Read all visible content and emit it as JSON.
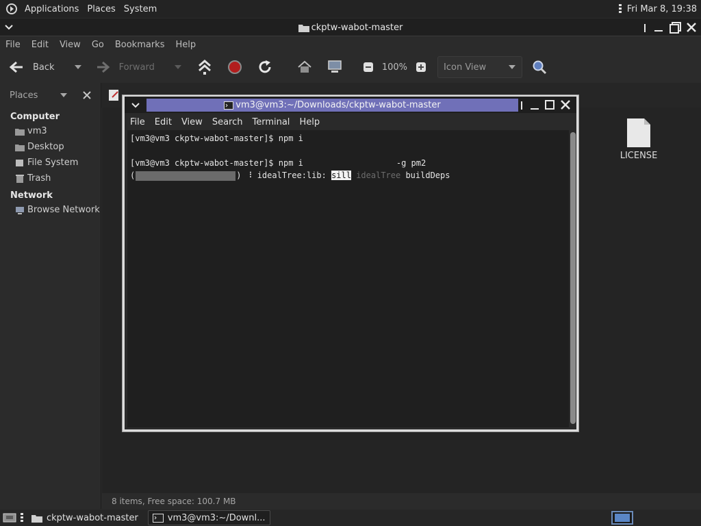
{
  "top_panel": {
    "menus": [
      "Applications",
      "Places",
      "System"
    ],
    "clock": "Fri Mar  8, 19:38"
  },
  "file_manager": {
    "title": "ckptw-wabot-master",
    "menus": [
      "File",
      "Edit",
      "View",
      "Go",
      "Bookmarks",
      "Help"
    ],
    "toolbar": {
      "back": "Back",
      "forward": "Forward",
      "zoom": "100%",
      "view_mode": "Icon View"
    },
    "sidebar": {
      "header": "Places",
      "sections": [
        {
          "title": "Computer",
          "items": [
            "vm3",
            "Desktop",
            "File System",
            "Trash"
          ]
        },
        {
          "title": "Network",
          "items": [
            "Browse Network"
          ]
        }
      ]
    },
    "files": [
      "LICENSE"
    ],
    "status": "8 items, Free space: 100.7 MB"
  },
  "terminal": {
    "title": "vm3@vm3:~/Downloads/ckptw-wabot-master",
    "menus": [
      "File",
      "Edit",
      "View",
      "Search",
      "Terminal",
      "Help"
    ],
    "lines": {
      "l1": "[vm3@vm3 ckptw-wabot-master]$ npm i",
      "l2_prompt": "[vm3@vm3 ckptw-wabot-master]$ npm i",
      "l2_flag": "-g pm2",
      "l3_open": "(",
      "l3_mid": ") ",
      "l3_spinner": "⠸",
      "l3_tree": " idealTree:lib: ",
      "l3_sill": "sill",
      "l3_ideal": " idealTree",
      "l3_deps": " buildDeps"
    }
  },
  "taskbar": {
    "tasks": [
      "ckptw-wabot-master",
      "vm3@vm3:~/Downl..."
    ]
  }
}
